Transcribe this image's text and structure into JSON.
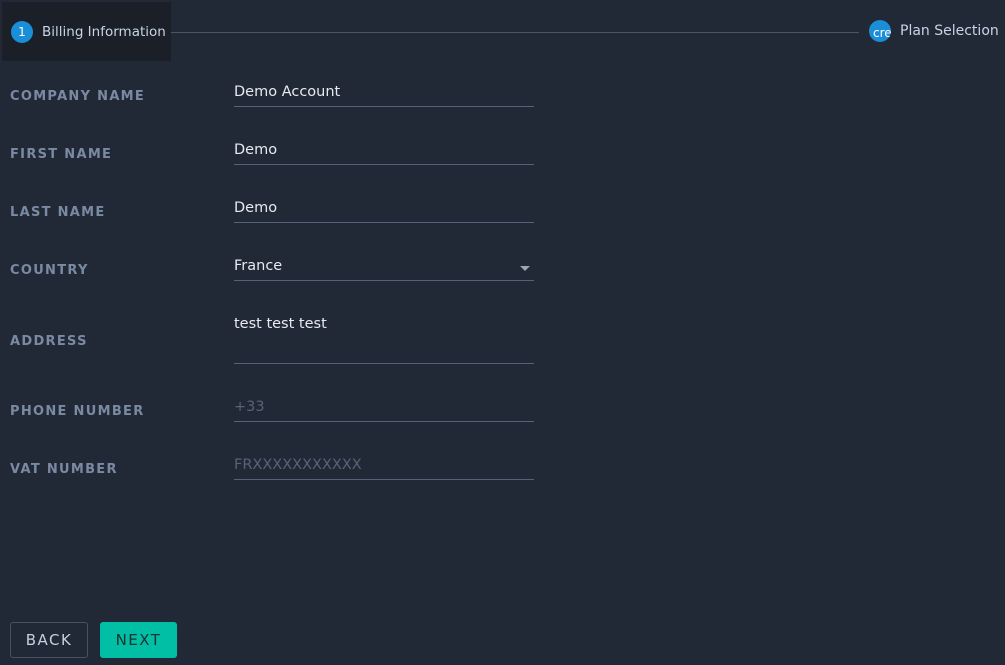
{
  "stepper": {
    "steps": [
      {
        "number": "1",
        "label": "Billing Information",
        "state": "active"
      },
      {
        "number": "cre",
        "label": "Plan Selection",
        "state": "pending"
      }
    ],
    "accent": "#1a8fd8"
  },
  "form": {
    "company_name": {
      "label": "Company Name",
      "value": "Demo Account"
    },
    "first_name": {
      "label": "First Name",
      "value": "Demo"
    },
    "last_name": {
      "label": "Last Name",
      "value": "Demo"
    },
    "country": {
      "label": "Country",
      "value": "France"
    },
    "address": {
      "label": "Address",
      "value": "test test test"
    },
    "phone_number": {
      "label": "Phone Number",
      "value": "",
      "placeholder": "+33"
    },
    "vat_number": {
      "label": "VAT Number",
      "value": "",
      "placeholder": "FRXXXXXXXXXXX"
    }
  },
  "actions": {
    "back_label": "BACK",
    "next_label": "NEXT",
    "next_color": "#00bfa5"
  }
}
